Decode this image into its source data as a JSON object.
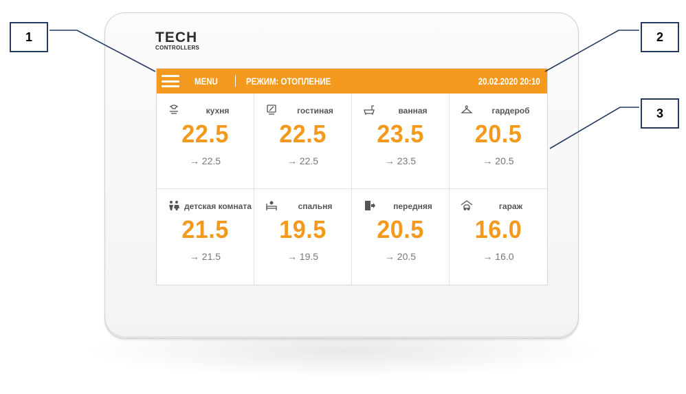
{
  "callouts": {
    "one": "1",
    "two": "2",
    "three": "3"
  },
  "logo": {
    "main": "TECH",
    "sub": "CONTROLLERS"
  },
  "topbar": {
    "menu_label": "MENU",
    "mode_label": "РЕЖИМ: ОТОПЛЕНИЕ",
    "datetime": "20.02.2020 20:10"
  },
  "zones": [
    {
      "name": "кухня",
      "icon": "kitchen-icon",
      "temp": "22.5",
      "target": "→ 22.5"
    },
    {
      "name": "гостиная",
      "icon": "tv-icon",
      "temp": "22.5",
      "target": "→ 22.5"
    },
    {
      "name": "ванная",
      "icon": "bathtub-icon",
      "temp": "23.5",
      "target": "→ 23.5"
    },
    {
      "name": "гардероб",
      "icon": "hanger-icon",
      "temp": "20.5",
      "target": "→ 20.5"
    },
    {
      "name": "детская комната",
      "icon": "children-icon",
      "temp": "21.5",
      "target": "→ 21.5"
    },
    {
      "name": "спальня",
      "icon": "bed-icon",
      "temp": "19.5",
      "target": "→ 19.5"
    },
    {
      "name": "передняя",
      "icon": "door-icon",
      "temp": "20.5",
      "target": "→ 20.5"
    },
    {
      "name": "гараж",
      "icon": "car-garage-icon",
      "temp": "16.0",
      "target": "→ 16.0"
    }
  ],
  "colors": {
    "accent": "#f39a1e",
    "callout_border": "#243a5e"
  }
}
